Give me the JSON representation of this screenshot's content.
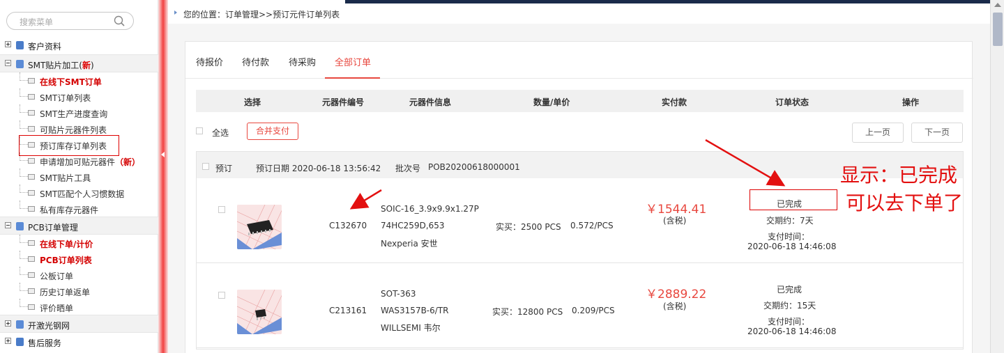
{
  "search": {
    "placeholder": "搜索菜单"
  },
  "sidebar": {
    "groups": [
      {
        "label": "客户资料"
      },
      {
        "label": "SMT贴片加工(",
        "badge": "新",
        "tail": ")"
      },
      {
        "label": "PCB订单管理"
      },
      {
        "label": "开激光钢网"
      },
      {
        "label": "售后服务"
      }
    ],
    "smt_items": [
      "在线下SMT订单",
      "SMT订单列表",
      "SMT生产进度查询",
      "可贴片元器件列表",
      "预订库存订单列表",
      "申请增加可贴元器件",
      "SMT贴片工具",
      "SMT匹配个人习惯数据",
      "私有库存元器件"
    ],
    "smt_new_badge": "（新）",
    "pcb_items": [
      "在线下单/计价",
      "PCB订单列表",
      "公板订单",
      "历史订单返单",
      "评价晒单"
    ]
  },
  "breadcrumb": "您的位置：订单管理>>预订元件订单列表",
  "tabs": [
    "待报价",
    "待付款",
    "待采购",
    "全部订单"
  ],
  "table": {
    "headers": [
      "选择",
      "元器件编号",
      "元器件信息",
      "数量/单价",
      "实付款",
      "订单状态",
      "操作"
    ]
  },
  "toolbar": {
    "select_all": "全选",
    "merge_pay": "合并支付",
    "prev_page": "上一页",
    "next_page": "下一页"
  },
  "order": {
    "type": "预订",
    "date_label": "预订日期 2020-06-18 13:56:42",
    "batch_label": "批次号",
    "batch_no": "POB20200618000001",
    "rows": [
      {
        "part_no": "C132670",
        "info": [
          "SOIC-16_3.9x9.9x1.27P",
          "74HC259D,653",
          "Nexperia 安世"
        ],
        "qty": "实买：2500 PCS",
        "unit": "0.572/PCS",
        "price": "￥1544.41",
        "tax": "(含税)",
        "status": "已完成",
        "lead": "交期约：7天",
        "paid_label": "支付时间：",
        "paid_time": "2020-06-18 14:46:08"
      },
      {
        "part_no": "C213161",
        "info": [
          "SOT-363",
          "WAS3157B-6/TR",
          "WILLSEMI 韦尔"
        ],
        "qty": "实买：12800 PCS",
        "unit": "0.209/PCS",
        "price": "￥2889.22",
        "tax": "(含税)",
        "status": "已完成",
        "lead": "交期约：15天",
        "paid_label": "支付时间：",
        "paid_time": "2020-06-18 14:46:08"
      }
    ]
  },
  "annotation": {
    "line1": "显示：已完成",
    "line2": "可以去下单了"
  },
  "colors": {
    "accent": "#e8473e",
    "annotation": "#e31010"
  }
}
